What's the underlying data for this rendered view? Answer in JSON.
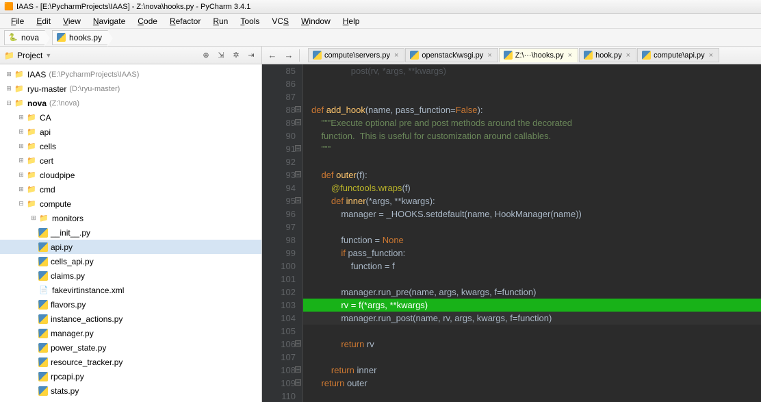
{
  "window_title": "IAAS - [E:\\PycharmProjects\\IAAS] - Z:\\nova\\hooks.py - PyCharm 3.4.1",
  "menu": [
    "File",
    "Edit",
    "View",
    "Navigate",
    "Code",
    "Refactor",
    "Run",
    "Tools",
    "VCS",
    "Window",
    "Help"
  ],
  "menu_ul": [
    0,
    0,
    0,
    0,
    0,
    0,
    0,
    0,
    2,
    0,
    0
  ],
  "breadcrumb": [
    {
      "icon": "py",
      "label": "nova"
    },
    {
      "icon": "pyf",
      "label": "hooks.py"
    }
  ],
  "project_header": "Project",
  "tree": [
    {
      "d": 0,
      "tw": "+",
      "icon": "folder",
      "label": "IAAS",
      "path": "(E:\\PycharmProjects\\IAAS)"
    },
    {
      "d": 0,
      "tw": "+",
      "icon": "folder",
      "label": "ryu-master",
      "path": "(D:\\ryu-master)"
    },
    {
      "d": 0,
      "tw": "-",
      "icon": "folder",
      "label": "nova",
      "path": "(Z:\\nova)",
      "bold": true
    },
    {
      "d": 1,
      "tw": "+",
      "icon": "folder",
      "label": "CA"
    },
    {
      "d": 1,
      "tw": "+",
      "icon": "folder",
      "label": "api"
    },
    {
      "d": 1,
      "tw": "+",
      "icon": "folder",
      "label": "cells"
    },
    {
      "d": 1,
      "tw": "+",
      "icon": "folder",
      "label": "cert"
    },
    {
      "d": 1,
      "tw": "+",
      "icon": "folder",
      "label": "cloudpipe"
    },
    {
      "d": 1,
      "tw": "+",
      "icon": "folder",
      "label": "cmd"
    },
    {
      "d": 1,
      "tw": "-",
      "icon": "folder",
      "label": "compute"
    },
    {
      "d": 2,
      "tw": "+",
      "icon": "folder",
      "label": "monitors"
    },
    {
      "d": 2,
      "tw": "",
      "icon": "pyf",
      "label": "__init__.py"
    },
    {
      "d": 2,
      "tw": "",
      "icon": "pyf",
      "label": "api.py",
      "sel": true
    },
    {
      "d": 2,
      "tw": "",
      "icon": "pyf",
      "label": "cells_api.py"
    },
    {
      "d": 2,
      "tw": "",
      "icon": "pyf",
      "label": "claims.py"
    },
    {
      "d": 2,
      "tw": "",
      "icon": "xml",
      "label": "fakevirtinstance.xml"
    },
    {
      "d": 2,
      "tw": "",
      "icon": "pyf",
      "label": "flavors.py"
    },
    {
      "d": 2,
      "tw": "",
      "icon": "pyf",
      "label": "instance_actions.py"
    },
    {
      "d": 2,
      "tw": "",
      "icon": "pyf",
      "label": "manager.py"
    },
    {
      "d": 2,
      "tw": "",
      "icon": "pyf",
      "label": "power_state.py"
    },
    {
      "d": 2,
      "tw": "",
      "icon": "pyf",
      "label": "resource_tracker.py"
    },
    {
      "d": 2,
      "tw": "",
      "icon": "pyf",
      "label": "rpcapi.py"
    },
    {
      "d": 2,
      "tw": "",
      "icon": "pyf",
      "label": "stats.py"
    }
  ],
  "tabs": [
    {
      "label": "compute\\servers.py",
      "active": false
    },
    {
      "label": "openstack\\wsgi.py",
      "active": false
    },
    {
      "label": "Z:\\···\\hooks.py",
      "active": true
    },
    {
      "label": "hook.py",
      "active": false
    },
    {
      "label": "compute\\api.py",
      "active": false
    }
  ],
  "code": {
    "start": 85,
    "lines": [
      {
        "n": 85,
        "t": "                post(rv, *args, **kwargs)",
        "faded": true
      },
      {
        "n": 86,
        "t": ""
      },
      {
        "n": 87,
        "t": ""
      },
      {
        "n": 88,
        "fold": "-",
        "html": "<span class='kw'>def</span> <span class='fn'>add_hook</span>(name, pass_function=<span class='kw'>False</span>):"
      },
      {
        "n": 89,
        "fold": "-",
        "html": "    <span class='str'>\"\"\"Execute optional pre and post methods around the decorated</span>"
      },
      {
        "n": 90,
        "html": "<span class='str'>    function.  This is useful for customization around callables.</span>"
      },
      {
        "n": 91,
        "fold": "_",
        "html": "<span class='str'>    \"\"\"</span>"
      },
      {
        "n": 92,
        "t": ""
      },
      {
        "n": 93,
        "fold": "-",
        "html": "    <span class='kw'>def</span> <span class='fn'>outer</span>(f):"
      },
      {
        "n": 94,
        "html": "        <span class='dec'>@functools.wraps</span>(f)"
      },
      {
        "n": 95,
        "fold": "-",
        "html": "        <span class='kw'>def</span> <span class='fn'>inner</span>(*args, **kwargs):"
      },
      {
        "n": 96,
        "html": "            manager = _HOOKS.setdefault(name, HookManager(name))"
      },
      {
        "n": 97,
        "t": ""
      },
      {
        "n": 98,
        "html": "            function = <span class='kw'>None</span>"
      },
      {
        "n": 99,
        "html": "            <span class='kw'>if</span> pass_function:"
      },
      {
        "n": 100,
        "html": "                function = f"
      },
      {
        "n": 101,
        "t": ""
      },
      {
        "n": 102,
        "html": "            manager.run_pre(name, args, kwargs, f=function)"
      },
      {
        "n": 103,
        "hl": true,
        "html": "            rv = f(*args, **kwargs)"
      },
      {
        "n": 104,
        "caret": true,
        "html": "            manager.run_post(name, rv, args, kwargs, f=function)"
      },
      {
        "n": 105,
        "t": ""
      },
      {
        "n": 106,
        "fold": "_",
        "html": "            <span class='kw'>return</span> rv"
      },
      {
        "n": 107,
        "t": ""
      },
      {
        "n": 108,
        "fold": "_",
        "html": "        <span class='kw'>return</span> inner"
      },
      {
        "n": 109,
        "fold": "_",
        "html": "    <span class='kw'>return</span> outer"
      },
      {
        "n": 110,
        "t": ""
      }
    ]
  }
}
